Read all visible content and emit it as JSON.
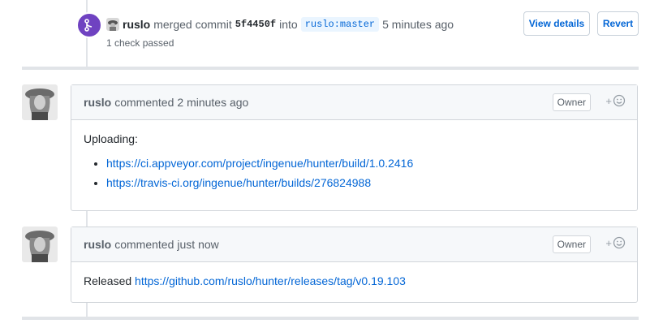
{
  "merge_event": {
    "author": "ruslo",
    "action_text": "merged commit",
    "commit_sha": "5f4450f",
    "into_text": "into",
    "branch": "ruslo:master",
    "time": "5 minutes ago",
    "check_status": "1 check passed",
    "view_details_label": "View details",
    "revert_label": "Revert",
    "badge_color": "#6f42c1"
  },
  "comments": [
    {
      "author": "ruslo",
      "action": "commented",
      "time": "2 minutes ago",
      "role_badge": "Owner",
      "reaction_plus": "+",
      "body_text": "Uploading:",
      "links": [
        "https://ci.appveyor.com/project/ingenue/hunter/build/1.0.2416",
        "https://travis-ci.org/ingenue/hunter/builds/276824988"
      ]
    },
    {
      "author": "ruslo",
      "action": "commented",
      "time": "just now",
      "role_badge": "Owner",
      "reaction_plus": "+",
      "body_prefix": "Released",
      "body_link": "https://github.com/ruslo/hunter/releases/tag/v0.19.103"
    }
  ],
  "colors": {
    "link": "#0366d6",
    "border": "#d1d5da",
    "header_bg": "#f6f8fa"
  }
}
